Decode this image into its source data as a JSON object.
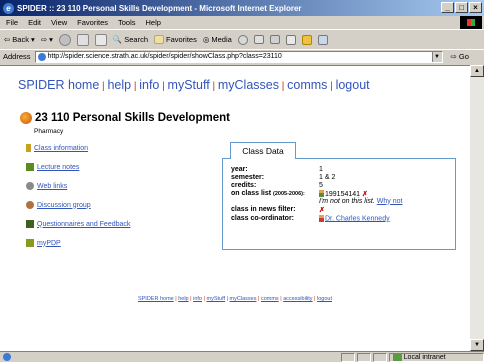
{
  "window": {
    "title": "SPIDER :: 23 110 Personal Skills Development - Microsoft Internet Explorer"
  },
  "menu": [
    "File",
    "Edit",
    "View",
    "Favorites",
    "Tools",
    "Help"
  ],
  "toolbar": {
    "back": "Back",
    "search": "Search",
    "favorites": "Favorites",
    "media": "Media"
  },
  "address": {
    "label": "Address",
    "url": "http://spider.science.strath.ac.uk/spider/spider/showClass.php?class=23110",
    "go": "Go"
  },
  "nav": [
    "SPIDER home",
    "help",
    "info",
    "myStuff",
    "myClasses",
    "comms",
    "logout"
  ],
  "page": {
    "title": "23 110 Personal Skills Development",
    "department": "Pharmacy"
  },
  "sidebar": [
    {
      "label": "Class information",
      "icon": "person-icon",
      "color": "#c9a020"
    },
    {
      "label": "Lecture notes",
      "icon": "notes-icon",
      "color": "#5a8a20"
    },
    {
      "label": "Web links",
      "icon": "links-icon",
      "color": "#8a8a8a"
    },
    {
      "label": "Discussion group",
      "icon": "discussion-icon",
      "color": "#b07040"
    },
    {
      "label": "Questionnaires and Feedback",
      "icon": "questionnaire-icon",
      "color": "#406020"
    },
    {
      "label": "myPDP",
      "icon": "pdp-icon",
      "color": "#8a9a20"
    }
  ],
  "class_data": {
    "tab": "Class Data",
    "rows": {
      "year": {
        "key": "year:",
        "value": "1"
      },
      "semester": {
        "key": "semester:",
        "value": "1 & 2"
      },
      "credits": {
        "key": "credits:",
        "value": "5"
      },
      "class_list": {
        "key": "on class list",
        "years": "(2005-2006):",
        "value": "199154141",
        "note": "I'm not on this list.",
        "link": "Why not"
      },
      "news": {
        "key": "class in news filter:"
      },
      "coordinator": {
        "key": "class co-ordinator:",
        "value": "Dr. Charles Kennedy"
      }
    }
  },
  "footer": [
    "SPIDER home",
    "help",
    "info",
    "myStuff",
    "myClasses",
    "comms",
    "accessibility",
    "logout"
  ],
  "status": {
    "zone": "Local intranet"
  }
}
